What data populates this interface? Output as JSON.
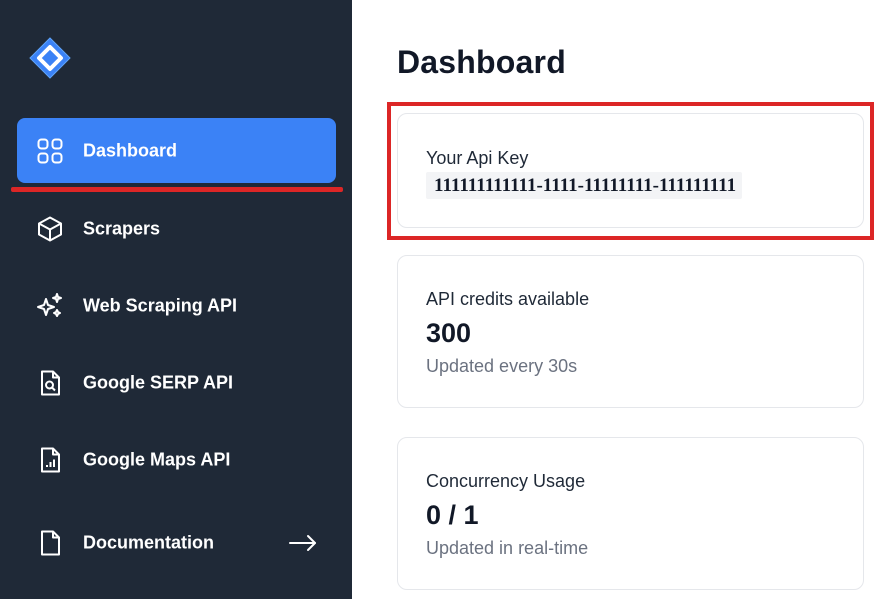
{
  "app": {
    "logo_icon": "diamond-logo-icon",
    "brand_color": "#3b82f6"
  },
  "sidebar": {
    "items": [
      {
        "label": "Dashboard",
        "icon": "grid-icon",
        "active": true
      },
      {
        "label": "Scrapers",
        "icon": "cube-icon"
      },
      {
        "label": "Web Scraping API",
        "icon": "sparkles-icon"
      },
      {
        "label": "Google SERP API",
        "icon": "document-search-icon"
      },
      {
        "label": "Google Maps API",
        "icon": "document-chart-icon"
      },
      {
        "label": "Documentation",
        "icon": "document-icon",
        "trailing_icon": "arrow-right-icon"
      }
    ]
  },
  "main": {
    "title": "Dashboard",
    "api_key_card": {
      "label": "Your Api Key",
      "value": "111111111111-1111-11111111-111111111"
    },
    "credits_card": {
      "label": "API credits available",
      "value": "300",
      "subtitle": "Updated every 30s"
    },
    "concurrency_card": {
      "label": "Concurrency Usage",
      "value": "0 / 1",
      "subtitle": "Updated in real-time"
    }
  },
  "annotation_color": "#dc2626"
}
